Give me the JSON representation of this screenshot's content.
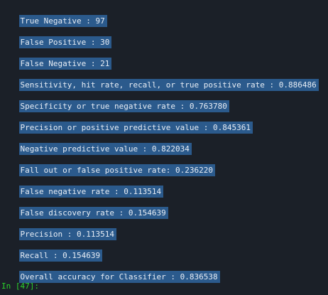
{
  "output": {
    "lines": [
      "True Negative : 97",
      "False Positive : 30",
      "False Negative : 21",
      "Sensitivity, hit rate, recall, or true positive rate : 0.886486",
      "Specificity or true negative rate : 0.763780",
      "Precision or positive predictive value : 0.845361",
      "Negative predictive value : 0.822034",
      "Fall out or false positive rate: 0.236220",
      "False negative rate : 0.113514",
      "False discovery rate : 0.154639",
      "Precision : 0.113514",
      "Recall : 0.154639",
      "Overall accuracy for Classifier : 0.836538"
    ]
  },
  "prompt": {
    "label": "In [47]:"
  },
  "colors": {
    "background": "#1b2028",
    "selection": "#2b5a8c",
    "prompt": "#2bd12b"
  }
}
